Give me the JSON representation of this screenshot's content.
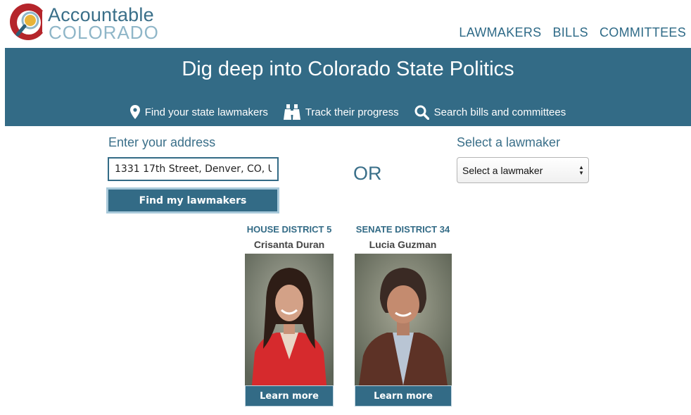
{
  "logo": {
    "line1": "Accountable",
    "line2": "COLORADO"
  },
  "nav": {
    "items": [
      "LAWMAKERS",
      "BILLS",
      "COMMITTEES"
    ]
  },
  "banner": {
    "title": "Dig deep into Colorado State Politics",
    "features": [
      {
        "icon": "map-pin-icon",
        "label": "Find your state lawmakers"
      },
      {
        "icon": "binoculars-icon",
        "label": "Track their progress"
      },
      {
        "icon": "search-icon",
        "label": "Search bills and committees"
      }
    ]
  },
  "address": {
    "label": "Enter your address",
    "value": "1331 17th Street, Denver, CO, U",
    "button": "Find my lawmakers"
  },
  "or_text": "OR",
  "lawmaker_select": {
    "label": "Select a lawmaker",
    "selected": "Select a lawmaker"
  },
  "results": [
    {
      "district": "HOUSE DISTRICT 5",
      "name": "Crisanta Duran",
      "button": "Learn more"
    },
    {
      "district": "SENATE DISTRICT 34",
      "name": "Lucia Guzman",
      "button": "Learn more"
    }
  ],
  "colors": {
    "primary": "#336b86",
    "logo_red": "#b5252b",
    "logo_gold": "#e8b339",
    "logo_light": "#8fb6c8"
  }
}
